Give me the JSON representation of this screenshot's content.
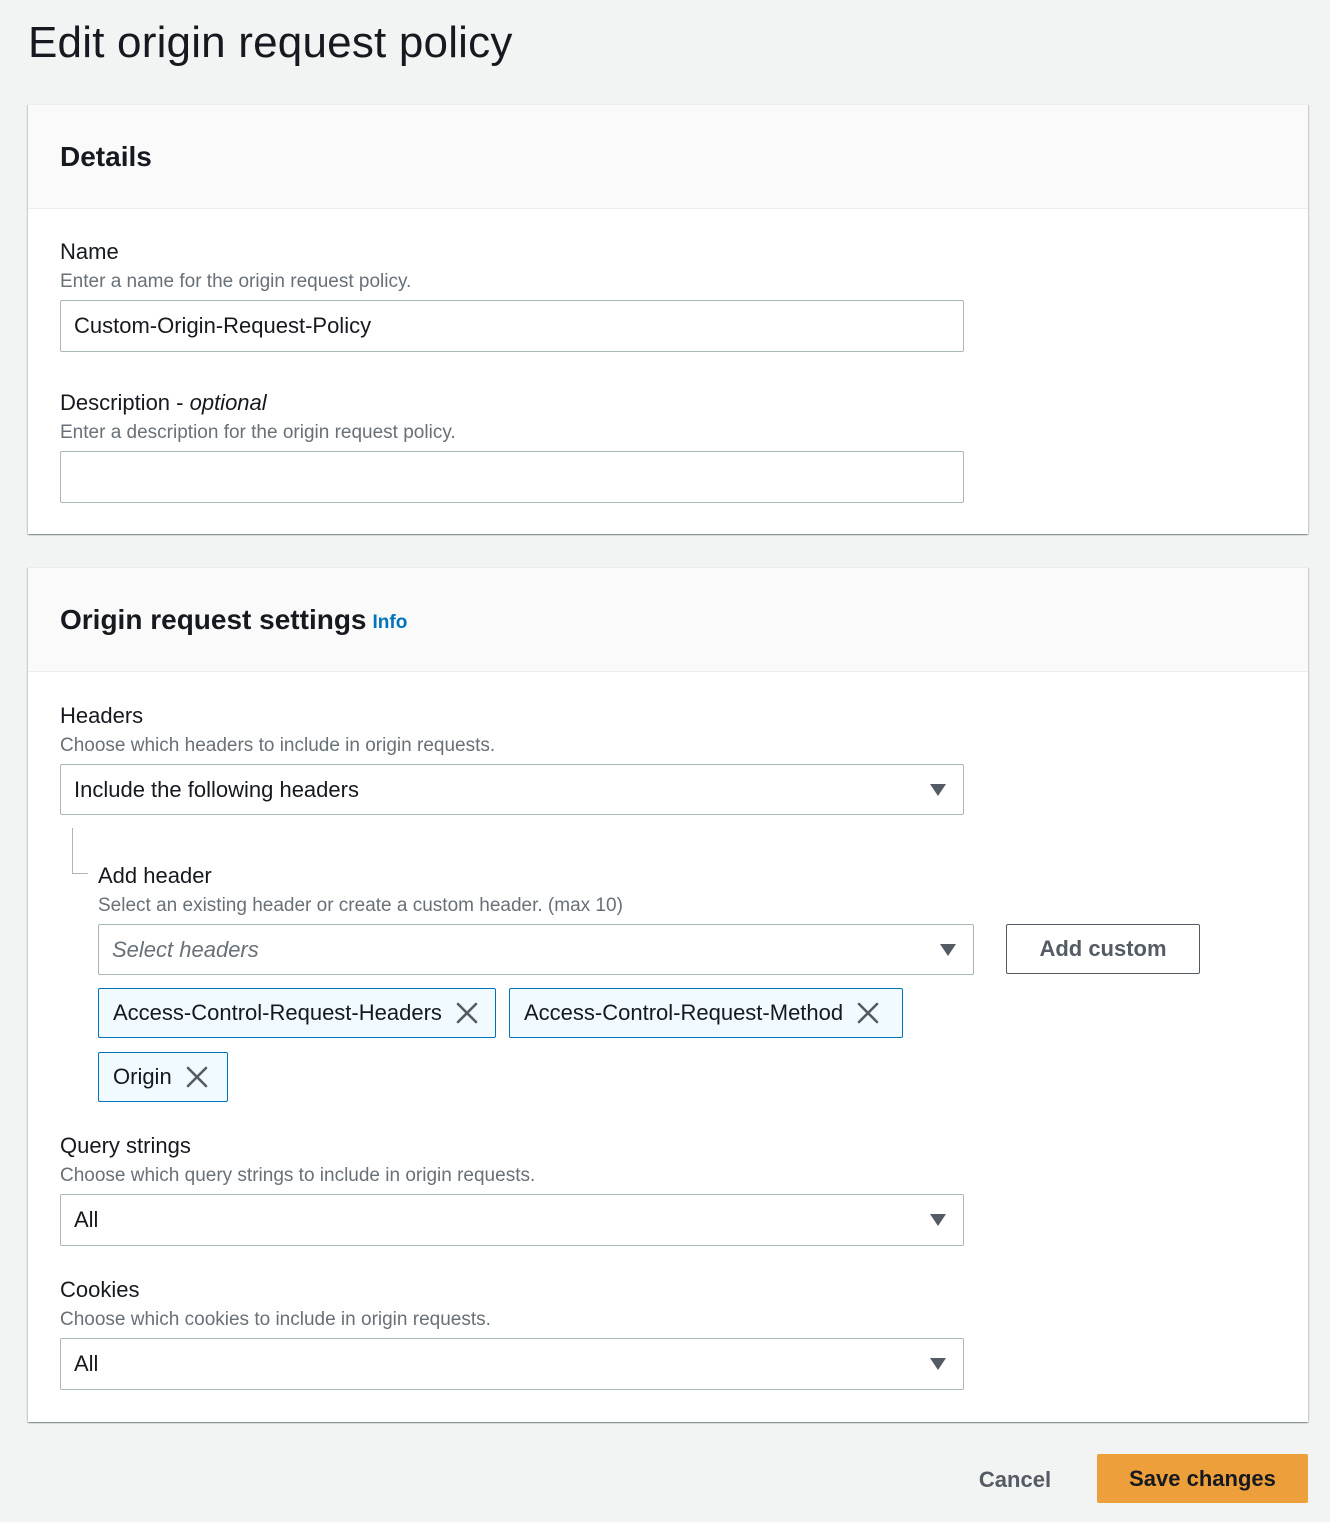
{
  "page": {
    "title": "Edit origin request policy"
  },
  "details": {
    "title": "Details",
    "name": {
      "label": "Name",
      "description": "Enter a name for the origin request policy.",
      "value": "Custom-Origin-Request-Policy"
    },
    "description": {
      "label": "Description - ",
      "label_optional": "optional",
      "description": "Enter a description for the origin request policy.",
      "value": ""
    }
  },
  "settings": {
    "title": "Origin request settings",
    "info_link": "Info",
    "headers": {
      "label": "Headers",
      "description": "Choose which headers to include in origin requests.",
      "selected": "Include the following headers"
    },
    "add_header": {
      "label": "Add header",
      "description": "Select an existing header or create a custom header. (max 10)",
      "placeholder": "Select headers",
      "add_custom_label": "Add custom",
      "tokens": [
        "Access-Control-Request-Headers",
        "Access-Control-Request-Method",
        "Origin"
      ]
    },
    "query_strings": {
      "label": "Query strings",
      "description": "Choose which query strings to include in origin requests.",
      "selected": "All"
    },
    "cookies": {
      "label": "Cookies",
      "description": "Choose which cookies to include in origin requests.",
      "selected": "All"
    }
  },
  "actions": {
    "cancel_label": "Cancel",
    "save_label": "Save changes"
  },
  "colors": {
    "primary_button": "#ec9f3a",
    "link": "#0073bb",
    "token_border": "#0073bb",
    "token_bg": "#f1faff"
  },
  "icons": {
    "dropdown": "caret-down-icon",
    "remove_token": "close-icon"
  }
}
